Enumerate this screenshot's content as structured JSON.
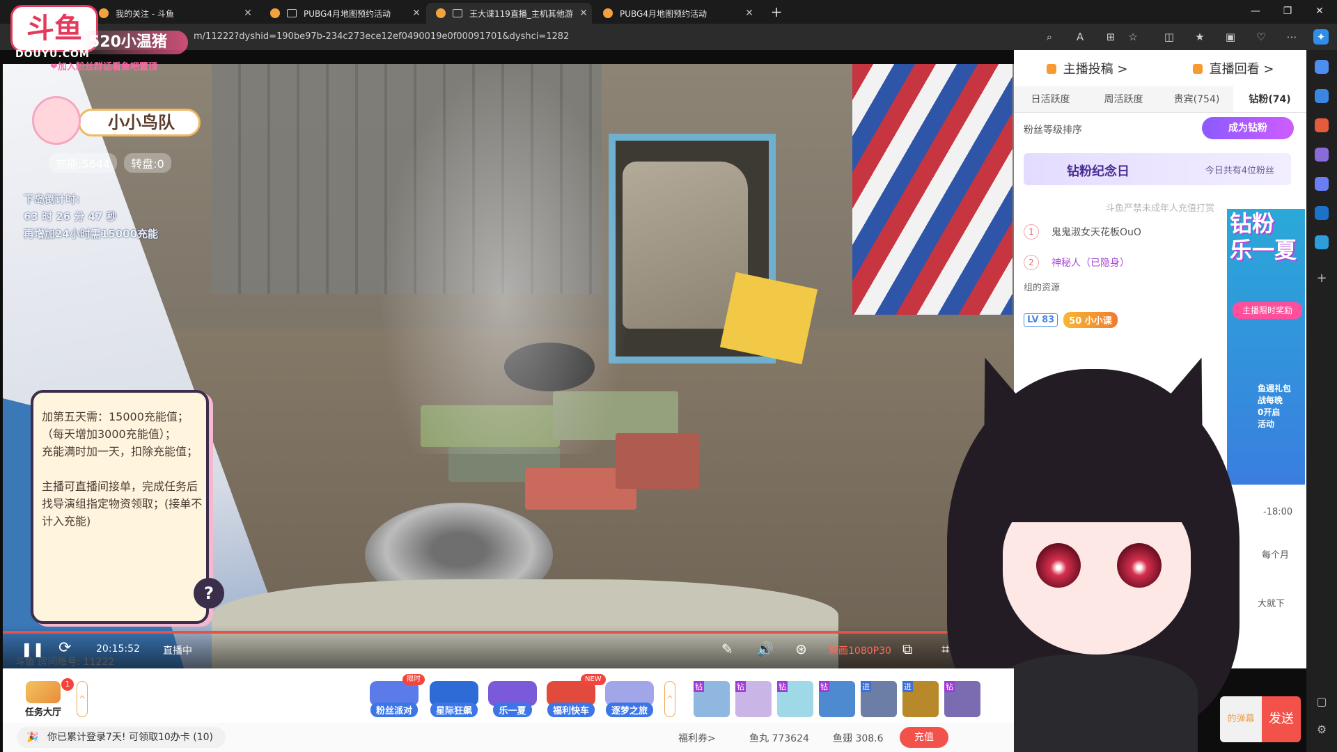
{
  "browser": {
    "tabs": [
      {
        "title": "我的关注 - 斗鱼",
        "active": false,
        "muted": false
      },
      {
        "title": "PUBG4月地图预约活动",
        "active": false,
        "muted": true
      },
      {
        "title": "王大谍119直播_主机其他游",
        "active": true,
        "muted": false
      },
      {
        "title": "PUBG4月地图预约活动",
        "active": false,
        "muted": false
      }
    ],
    "url": "m/11222?dyshid=190be97b-234c273ece12ef0490019e0f00091701&dyshci=1282"
  },
  "overlay": {
    "logo_text": "斗鱼",
    "logo_sub": "DOUYU.COM",
    "streamer_tag": "520小温猪",
    "pin_text": "❤加入粉丝群话看鱼吧置顶",
    "team_name": "小小鸟队",
    "energy": "充能:5644",
    "turntable": "转盘:0",
    "countdown": [
      "下岛倒计时:",
      "63 时 26 分 47 秒",
      "再增加24小时需15000充能"
    ],
    "notice": "加第五天需：15000充能值；\n（每天增加3000充能值）；\n充能满时加一天，扣除充能值；\n\n主播可直播间接单，完成任务后\n找导演组指定物资领取；(接单不\n计入充能)"
  },
  "player": {
    "time": "20:15:52",
    "status": "直播中",
    "quality": "原画1080P30",
    "room": "斗鱼 房间账号: 11222"
  },
  "sidepanel": {
    "head": [
      "主播投稿 >",
      "直播回看 >"
    ],
    "tabs": [
      "日活跃度",
      "周活跃度",
      "贵宾(754)",
      "钻粉(74)"
    ],
    "sort_label": "粉丝等级排序",
    "become_fan": "成为钻粉",
    "memorial_title": "钻粉纪念日",
    "memorial_right": "今日共有4位粉丝",
    "minor_note": "斗鱼严禁未成年人充值打赏",
    "ranks": [
      {
        "n": "1",
        "name": "鬼鬼淑女天花板OuO"
      },
      {
        "n": "2",
        "name": "神秘人（已隐身）"
      }
    ],
    "resource": "组的资源",
    "chat_level": "LV 83",
    "chat_fan": "50 小小课"
  },
  "promo": {
    "big": "钻粉\n乐一夏",
    "tag": "主播限时奖励",
    "gift": "鱼週礼包\n战每晚\n0开启\n活动",
    "time": "-18:00",
    "month": "每个月",
    "down": "大就下"
  },
  "bottom": {
    "task_hall": "任务大厅",
    "task_badge": "1",
    "activities": [
      {
        "label": "粉丝派对",
        "hot": "限时"
      },
      {
        "label": "星际狂飙",
        "hot": ""
      },
      {
        "label": "乐一夏",
        "hot": ""
      },
      {
        "label": "福利快车",
        "hot": "NEW"
      },
      {
        "label": "逐梦之旅",
        "hot": ""
      }
    ],
    "gift_tags": [
      "钻",
      "钻",
      "钻",
      "钻",
      "进",
      "进",
      "钻"
    ],
    "login_tip": "你已累计登录7天! 可领取10办卡 (10)",
    "coupon": "福利券>",
    "fishball": "鱼丸 773624",
    "fishwing": "鱼翅 308.6",
    "recharge": "充值",
    "danmu_hint": "的弹幕",
    "send": "发送"
  },
  "colors": {
    "accent": "#f3524a",
    "brand": "#f79a32",
    "fan_purple": "#8a5bff"
  }
}
